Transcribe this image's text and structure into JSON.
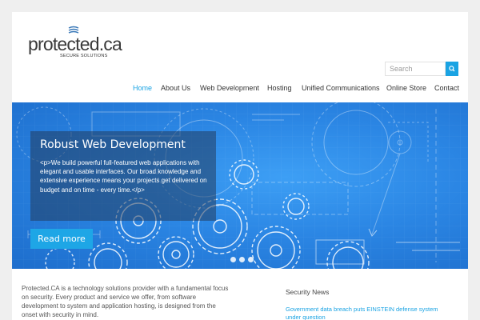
{
  "header": {
    "logo_text": "protected.ca",
    "logo_tagline": "SECURE SOLUTIONS",
    "search_placeholder": "Search"
  },
  "nav": {
    "items": [
      {
        "label": "Home",
        "active": true
      },
      {
        "label": "About Us",
        "active": false
      },
      {
        "label": "Web Development",
        "active": false
      },
      {
        "label": "Hosting",
        "active": false
      },
      {
        "label": "Unified Communications",
        "active": false
      },
      {
        "label": "Online Store",
        "active": false
      },
      {
        "label": "Contact",
        "active": false
      }
    ]
  },
  "hero": {
    "title": "Robust Web Development",
    "body": "<p>We build powerful full-featured web applications with elegant and usable interfaces. Our broad knowledge and extensive experience means your projects get delivered on budget and on time - every time.</p>",
    "button_label": "Read more",
    "slide_count": 3,
    "active_slide": 1
  },
  "intro": {
    "text": "Protected.CA is a technology solutions provider with a fundamental focus on security. Every product and service we offer, from software development to system and application hosting, is designed from the onset with security in mind."
  },
  "news": {
    "title": "Security News",
    "items": [
      {
        "label": "Government data breach puts EINSTEIN defense system under question"
      }
    ]
  },
  "colors": {
    "accent": "#1aa3e3",
    "page_background": "#efefef",
    "hero_blue": "#2b86e4"
  }
}
